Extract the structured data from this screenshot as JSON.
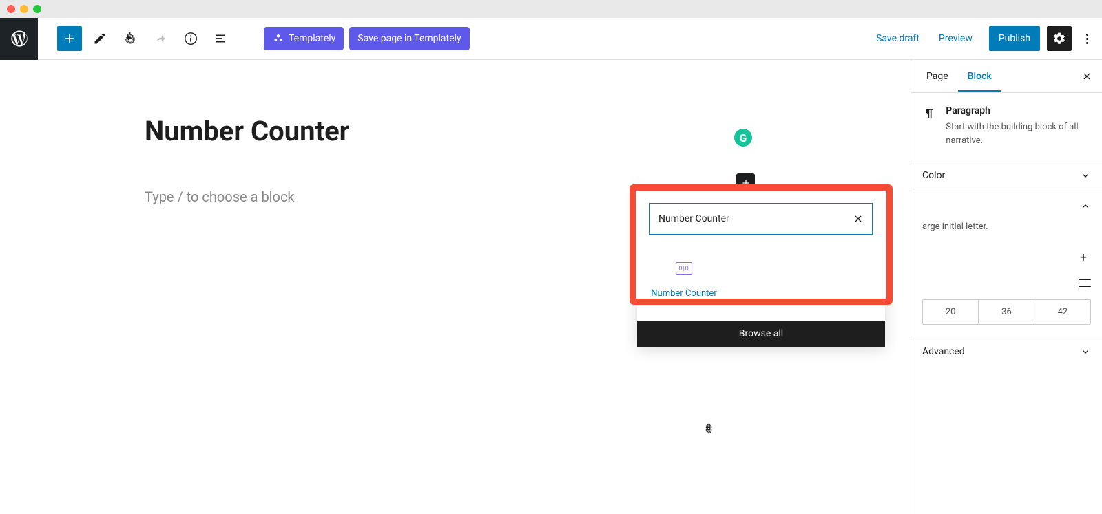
{
  "toolbar": {
    "templately_label": "Templately",
    "save_templately_label": "Save page in Templately",
    "save_draft_label": "Save draft",
    "preview_label": "Preview",
    "publish_label": "Publish"
  },
  "editor": {
    "post_title": "Number Counter",
    "paragraph_placeholder": "Type / to choose a block",
    "grammarly_badge": "G"
  },
  "inserter": {
    "search_value": "Number Counter",
    "result_label": "Number Counter",
    "browse_all_label": "Browse all"
  },
  "sidebar": {
    "tabs": {
      "page": "Page",
      "block": "Block"
    },
    "block_name": "Paragraph",
    "block_desc": "Start with the building block of all narrative.",
    "panels": {
      "color": "Color",
      "dropcap_hint_fragment": "arge initial letter.",
      "advanced": "Advanced"
    },
    "font_sizes": [
      "20",
      "36",
      "42"
    ]
  }
}
